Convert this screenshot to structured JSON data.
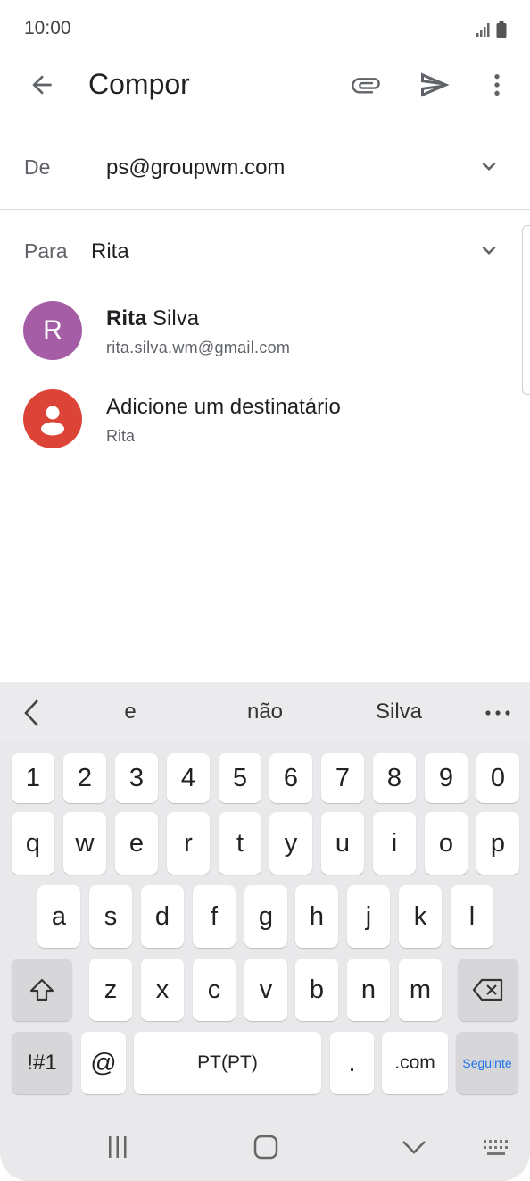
{
  "status_bar": {
    "time": "10:00",
    "signal_icon": "signal-icon",
    "battery_icon": "battery-icon"
  },
  "app_bar": {
    "title": "Compor",
    "icons": {
      "back": "back-arrow-icon",
      "attach": "paperclip-icon",
      "send": "send-icon",
      "more": "more-vert-icon"
    }
  },
  "from": {
    "label": "De",
    "value": "ps@groupwm.com"
  },
  "to": {
    "label": "Para",
    "value": "Rita"
  },
  "suggestions": [
    {
      "initial": "R",
      "first": "Rita",
      "last": "Silva",
      "email": "rita.silva.wm@gmail.com",
      "color": "#a55ea5"
    },
    {
      "title": "Adicione um destinatário",
      "subtitle": "Rita",
      "color": "#db4437"
    }
  ],
  "keyboard": {
    "predictions": [
      "e",
      "não",
      "Silva"
    ],
    "row1": [
      "1",
      "2",
      "3",
      "4",
      "5",
      "6",
      "7",
      "8",
      "9",
      "0"
    ],
    "row2": [
      "q",
      "w",
      "e",
      "r",
      "t",
      "y",
      "u",
      "i",
      "o",
      "p"
    ],
    "row3": [
      "a",
      "s",
      "d",
      "f",
      "g",
      "h",
      "j",
      "k",
      "l"
    ],
    "row4": [
      "z",
      "x",
      "c",
      "v",
      "b",
      "n",
      "m"
    ],
    "sym": "!#1",
    "at": "@",
    "space": "PT(PT)",
    "dot": ".",
    "dotcom": ".com",
    "next": "Seguinte"
  }
}
